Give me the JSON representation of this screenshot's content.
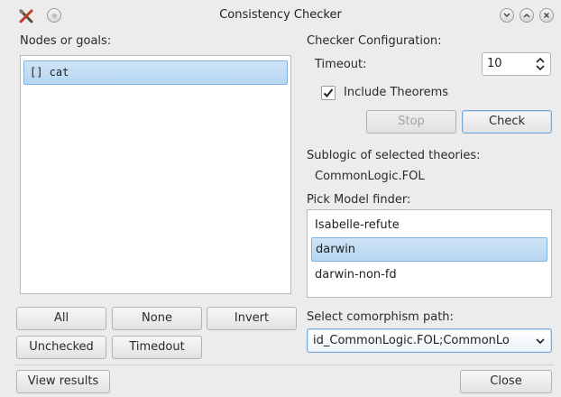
{
  "window": {
    "title": "Consistency Checker",
    "icons": [
      "app-tools-icon",
      "pin-icon",
      "minimize-icon",
      "maximize-icon",
      "close-icon"
    ]
  },
  "left": {
    "nodes_label": "Nodes or goals:",
    "nodes": [
      {
        "label": "[] cat",
        "selected": true
      }
    ],
    "buttons": {
      "all": "All",
      "none": "None",
      "invert": "Invert",
      "unchecked": "Unchecked",
      "timedout": "Timedout"
    }
  },
  "right": {
    "config_label": "Checker Configuration:",
    "timeout_label": "Timeout:",
    "timeout_value": "10",
    "include_theorems_label": "Include Theorems",
    "include_theorems_checked": true,
    "stop_label": "Stop",
    "check_label": "Check",
    "sublogic_label": "Sublogic of selected theories:",
    "sublogic_value": "CommonLogic.FOL",
    "model_finder_label": "Pick Model finder:",
    "model_finders": [
      "Isabelle-refute",
      "darwin",
      "darwin-non-fd"
    ],
    "model_finder_selected": "darwin",
    "comorphism_label": "Select comorphism path:",
    "comorphism_value": "id_CommonLogic.FOL;CommonLo"
  },
  "footer": {
    "view_results_label": "View results",
    "close_label": "Close"
  }
}
